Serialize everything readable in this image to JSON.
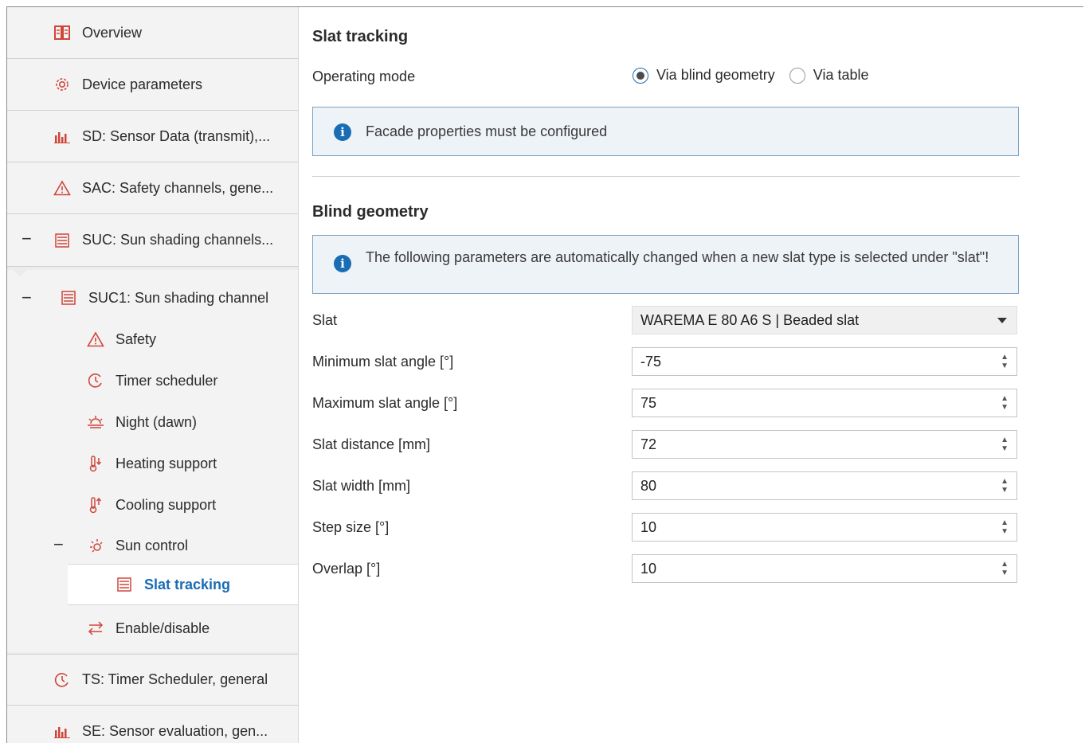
{
  "sidebar": {
    "items": [
      {
        "label": "Overview",
        "icon": "book-icon"
      },
      {
        "label": "Device parameters",
        "icon": "gear-icon"
      },
      {
        "label": "SD: Sensor Data (transmit),...",
        "icon": "chart-icon"
      },
      {
        "label": "SAC: Safety channels, gene...",
        "icon": "warning-icon"
      },
      {
        "label": "SUC: Sun shading channels...",
        "icon": "blind-icon",
        "expander": "−"
      },
      {
        "label": "SUC1:  Sun shading channel",
        "icon": "blind-icon",
        "expander": "−"
      },
      {
        "label": "Safety",
        "icon": "warning-icon"
      },
      {
        "label": "Timer scheduler",
        "icon": "clock-icon"
      },
      {
        "label": "Night (dawn)",
        "icon": "dawn-icon"
      },
      {
        "label": "Heating support",
        "icon": "thermometer-down-icon"
      },
      {
        "label": "Cooling support",
        "icon": "thermometer-up-icon"
      },
      {
        "label": "Sun control",
        "icon": "sun-icon",
        "expander": "−"
      },
      {
        "label": "Slat tracking",
        "icon": "blind-icon",
        "selected": true
      },
      {
        "label": "Enable/disable",
        "icon": "swap-icon"
      },
      {
        "label": "TS: Timer Scheduler, general",
        "icon": "clock-icon"
      },
      {
        "label": "SE: Sensor evaluation, gen...",
        "icon": "chart-icon"
      }
    ]
  },
  "main": {
    "section1_title": "Slat tracking",
    "operating_mode_label": "Operating mode",
    "radio_options": [
      "Via blind geometry",
      "Via table"
    ],
    "radio_selected": "Via blind geometry",
    "info1": "Facade properties must be configured",
    "section2_title": "Blind geometry",
    "info2": "The following parameters are automatically changed when a new slat type is selected under \"slat\"!",
    "fields": [
      {
        "label": "Slat",
        "value": "WAREMA E 80 A6 S | Beaded slat",
        "type": "select"
      },
      {
        "label": "Minimum slat angle [°]",
        "value": "-75",
        "type": "number"
      },
      {
        "label": "Maximum slat angle [°]",
        "value": "75",
        "type": "number"
      },
      {
        "label": "Slat distance [mm]",
        "value": "72",
        "type": "number"
      },
      {
        "label": "Slat width [mm]",
        "value": "80",
        "type": "number"
      },
      {
        "label": "Step size [°]",
        "value": "10",
        "type": "number"
      },
      {
        "label": "Overlap [°]",
        "value": "10",
        "type": "number"
      }
    ]
  },
  "colors": {
    "accent": "#1a6cb5",
    "icon_red": "#d0453a",
    "info_bg": "#eef3f8"
  }
}
